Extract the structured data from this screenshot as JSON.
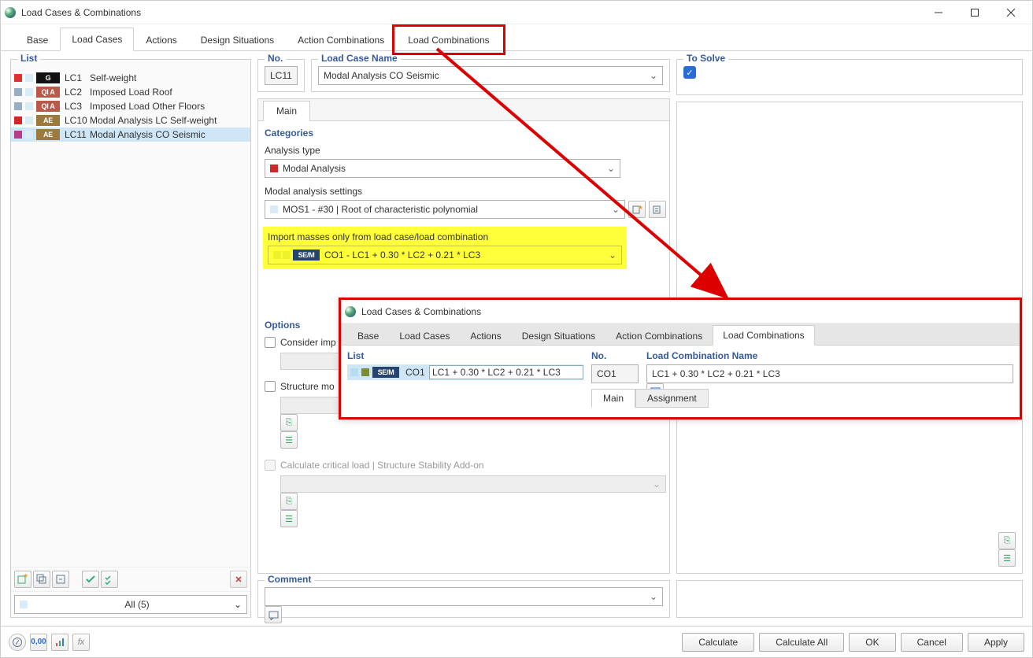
{
  "window_title": "Load Cases & Combinations",
  "top_tabs": [
    "Base",
    "Load Cases",
    "Actions",
    "Design Situations",
    "Action Combinations",
    "Load Combinations"
  ],
  "active_top_tab": "Load Cases",
  "list_label": "List",
  "lc_list": [
    {
      "sw": "#e03030",
      "sw2": "#d7ecf5",
      "badge": "G",
      "badge_bg": "#111",
      "no": "LC1",
      "name": "Self-weight"
    },
    {
      "sw": "#9aaec2",
      "sw2": "#d7ecf5",
      "badge": "QI A",
      "badge_bg": "#b85a4a",
      "no": "LC2",
      "name": "Imposed Load Roof"
    },
    {
      "sw": "#9aaec2",
      "sw2": "#d7ecf5",
      "badge": "QI A",
      "badge_bg": "#b85a4a",
      "no": "LC3",
      "name": "Imposed Load Other Floors"
    },
    {
      "sw": "#d02828",
      "sw2": "#d7ecf5",
      "badge": "AE",
      "badge_bg": "#9b7a3b",
      "no": "LC10",
      "name": "Modal Analysis LC Self-weight"
    },
    {
      "sw": "#b83a8a",
      "sw2": "#d7ecf5",
      "badge": "AE",
      "badge_bg": "#9b7a3b",
      "no": "LC11",
      "name": "Modal Analysis CO Seismic",
      "selected": true
    }
  ],
  "left_filter": "All (5)",
  "no_label": "No.",
  "lc_name_label": "Load Case Name",
  "to_solve_label": "To Solve",
  "no_value": "LC11",
  "lc_name_value": "Modal Analysis CO Seismic",
  "inner_tab": "Main",
  "sec_categories": "Categories",
  "analysis_type_label": "Analysis type",
  "analysis_type_value": "Modal Analysis",
  "analysis_type_sw": "#d02828",
  "modal_settings_label": "Modal analysis settings",
  "modal_settings_value": "MOS1 - #30 | Root of characteristic polynomial",
  "modal_settings_sw": "#d7ecf5",
  "import_label": "Import masses only from load case/load combination",
  "import_badge": "SE/M",
  "import_value": "CO1 - LC1 + 0.30 * LC2 + 0.21 * LC3",
  "sec_options": "Options",
  "opt1": "Consider imp",
  "opt2": "Structure mo",
  "opt3": "Calculate critical load | Structure Stability Add-on",
  "sec_comment": "Comment",
  "footer_buttons": [
    "Calculate",
    "Calculate All",
    "OK",
    "Cancel",
    "Apply"
  ],
  "popup": {
    "title": "Load Cases & Combinations",
    "tabs": [
      "Base",
      "Load Cases",
      "Actions",
      "Design Situations",
      "Action Combinations",
      "Load Combinations"
    ],
    "active_tab": "Load Combinations",
    "list_label": "List",
    "row": {
      "badge": "SE/M",
      "badge_bg": "#26456e",
      "sw1": "#b9ddf0",
      "sw2": "#7d8b36",
      "no": "CO1",
      "name": "LC1 + 0.30 * LC2 + 0.21 * LC3"
    },
    "no_label": "No.",
    "no_value": "CO1",
    "name_label": "Load Combination Name",
    "name_value": "LC1 + 0.30 * LC2 + 0.21 * LC3",
    "subtabs": [
      "Main",
      "Assignment"
    ]
  }
}
